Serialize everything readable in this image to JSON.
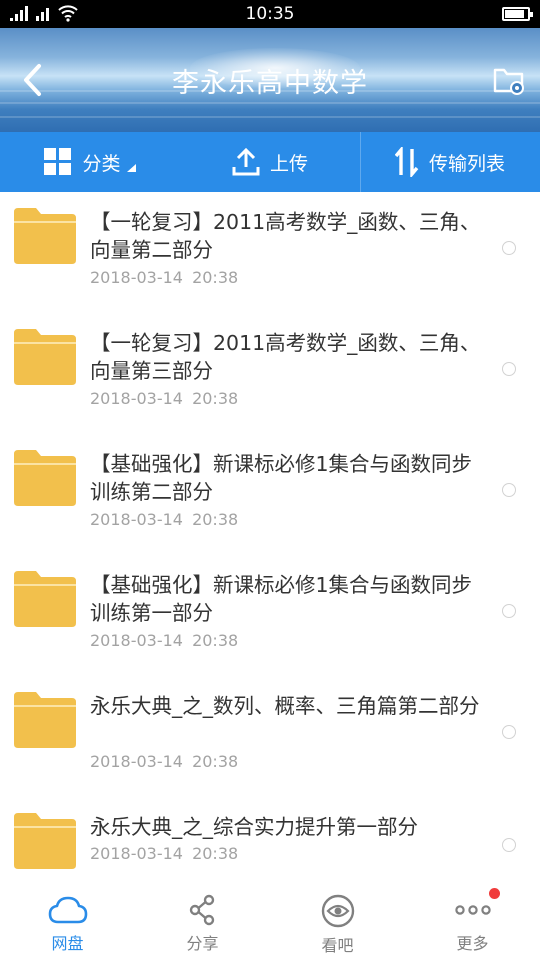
{
  "status_bar": {
    "time": "10:35"
  },
  "header": {
    "title": "李永乐高中数学",
    "back_icon": "back-arrow-icon",
    "settings_icon": "folder-settings-icon"
  },
  "toolbar": {
    "category_label": "分类",
    "upload_label": "上传",
    "transfer_label": "传输列表"
  },
  "files": [
    {
      "name": "【一轮复习】2011高考数学_函数、三角、向量第二部分",
      "date": "2018-03-14  20:38"
    },
    {
      "name": "【一轮复习】2011高考数学_函数、三角、向量第三部分",
      "date": "2018-03-14  20:38"
    },
    {
      "name": "【基础强化】新课标必修1集合与函数同步训练第二部分",
      "date": "2018-03-14  20:38"
    },
    {
      "name": "【基础强化】新课标必修1集合与函数同步训练第一部分",
      "date": "2018-03-14  20:38"
    },
    {
      "name": "永乐大典_之_数列、概率、三角篇第二部分",
      "date": "2018-03-14  20:38"
    },
    {
      "name": "永乐大典_之_综合实力提升第一部分",
      "date": "2018-03-14  20:38"
    }
  ],
  "bottom_nav": {
    "items": [
      {
        "label": "网盘",
        "icon": "cloud-icon",
        "active": true
      },
      {
        "label": "分享",
        "icon": "share-icon"
      },
      {
        "label": "看吧",
        "icon": "eye-icon"
      },
      {
        "label": "更多",
        "icon": "more-icon",
        "badge": true
      }
    ]
  },
  "colors": {
    "accent": "#2a8ce8",
    "folder": "#f2c04c",
    "badge": "#f03c3c"
  }
}
